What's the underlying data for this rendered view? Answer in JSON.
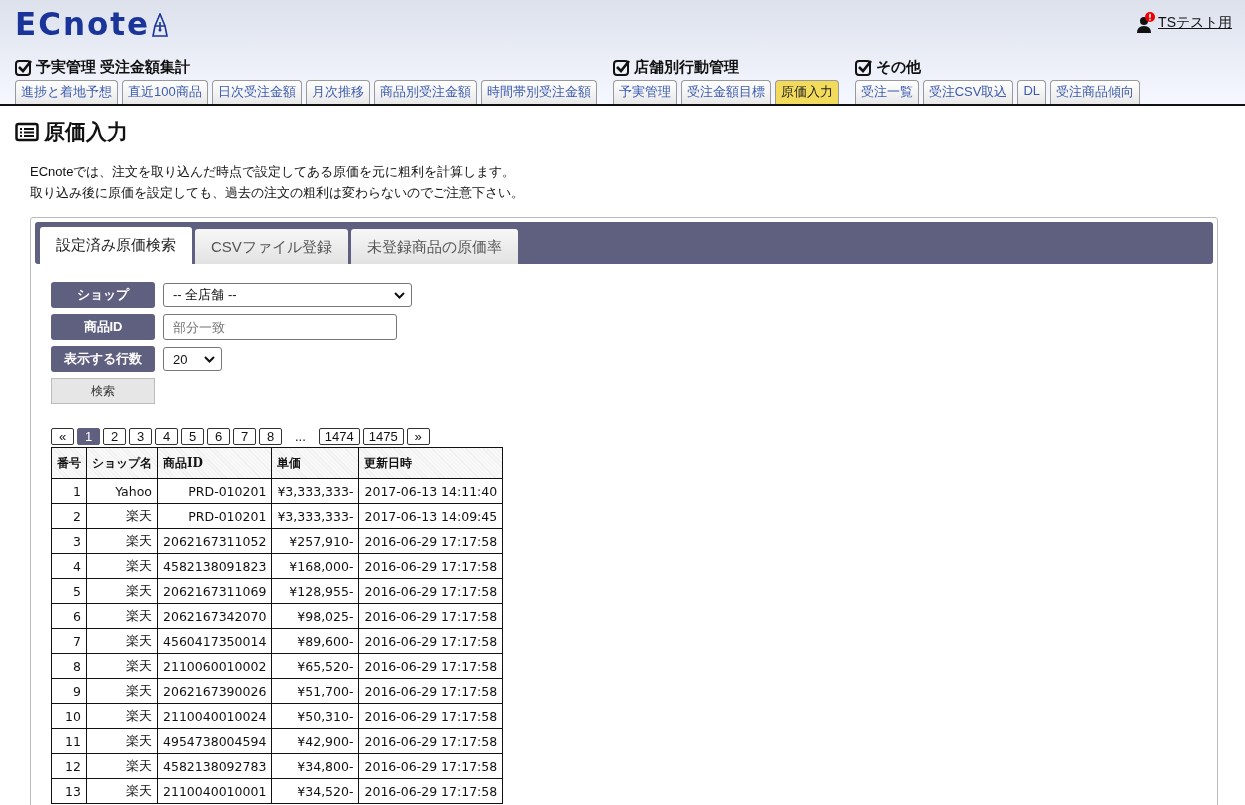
{
  "header": {
    "logo": "ECnote",
    "user": "TSテスト用"
  },
  "nav_groups": [
    {
      "title": "予実管理 受注金額集計",
      "checked": true,
      "tabs": [
        {
          "label": "進捗と着地予想",
          "selected": false
        },
        {
          "label": "直近100商品",
          "selected": false
        },
        {
          "label": "日次受注金額",
          "selected": false
        },
        {
          "label": "月次推移",
          "selected": false
        },
        {
          "label": "商品別受注金額",
          "selected": false
        },
        {
          "label": "時間帯別受注金額",
          "selected": false
        }
      ]
    },
    {
      "title": "店舗別行動管理",
      "checked": true,
      "tabs": [
        {
          "label": "予実管理",
          "selected": false
        },
        {
          "label": "受注金額目標",
          "selected": false
        },
        {
          "label": "原価入力",
          "selected": true
        }
      ]
    },
    {
      "title": "その他",
      "checked": true,
      "tabs": [
        {
          "label": "受注一覧",
          "selected": false
        },
        {
          "label": "受注CSV取込",
          "selected": false
        },
        {
          "label": "DL",
          "selected": false
        },
        {
          "label": "受注商品傾向",
          "selected": false
        }
      ]
    }
  ],
  "page": {
    "title": "原価入力",
    "description": [
      "ECnoteでは、注文を取り込んだ時点で設定してある原価を元に粗利を計算します。",
      "取り込み後に原価を設定しても、過去の注文の粗利は変わらないのでご注意下さい。"
    ]
  },
  "panel_tabs": [
    {
      "label": "設定済み原価検索",
      "selected": true
    },
    {
      "label": "CSVファイル登録",
      "selected": false
    },
    {
      "label": "未登録商品の原価率",
      "selected": false
    }
  ],
  "form": {
    "fields": [
      {
        "label": "ショップ",
        "kind": "select",
        "value": "-- 全店舗 --"
      },
      {
        "label": "商品ID",
        "kind": "text",
        "placeholder": "部分一致"
      },
      {
        "label": "表示する行数",
        "kind": "select",
        "value": "20"
      }
    ],
    "search_button": "検索"
  },
  "pagination": [
    {
      "kind": "page",
      "label": "«",
      "selected": false
    },
    {
      "kind": "page",
      "label": "1",
      "selected": true
    },
    {
      "kind": "page",
      "label": "2",
      "selected": false
    },
    {
      "kind": "page",
      "label": "3",
      "selected": false
    },
    {
      "kind": "page",
      "label": "4",
      "selected": false
    },
    {
      "kind": "page",
      "label": "5",
      "selected": false
    },
    {
      "kind": "page",
      "label": "6",
      "selected": false
    },
    {
      "kind": "page",
      "label": "7",
      "selected": false
    },
    {
      "kind": "page",
      "label": "8",
      "selected": false
    },
    {
      "kind": "ellipsis",
      "label": "..."
    },
    {
      "kind": "page",
      "label": "1474",
      "selected": false
    },
    {
      "kind": "page",
      "label": "1475",
      "selected": false
    },
    {
      "kind": "page",
      "label": "»",
      "selected": false
    }
  ],
  "table": {
    "columns": [
      "番号",
      "ショップ名",
      "商品ID",
      "単価",
      "更新日時"
    ],
    "rows": [
      [
        "1",
        "Yahoo",
        "PRD-010201",
        "¥3,333,333-",
        "2017-06-13 14:11:40"
      ],
      [
        "2",
        "楽天",
        "PRD-010201",
        "¥3,333,333-",
        "2017-06-13 14:09:45"
      ],
      [
        "3",
        "楽天",
        "2062167311052",
        "¥257,910-",
        "2016-06-29 17:17:58"
      ],
      [
        "4",
        "楽天",
        "4582138091823",
        "¥168,000-",
        "2016-06-29 17:17:58"
      ],
      [
        "5",
        "楽天",
        "2062167311069",
        "¥128,955-",
        "2016-06-29 17:17:58"
      ],
      [
        "6",
        "楽天",
        "2062167342070",
        "¥98,025-",
        "2016-06-29 17:17:58"
      ],
      [
        "7",
        "楽天",
        "4560417350014",
        "¥89,600-",
        "2016-06-29 17:17:58"
      ],
      [
        "8",
        "楽天",
        "2110060010002",
        "¥65,520-",
        "2016-06-29 17:17:58"
      ],
      [
        "9",
        "楽天",
        "2062167390026",
        "¥51,700-",
        "2016-06-29 17:17:58"
      ],
      [
        "10",
        "楽天",
        "2110040010024",
        "¥50,310-",
        "2016-06-29 17:17:58"
      ],
      [
        "11",
        "楽天",
        "4954738004594",
        "¥42,900-",
        "2016-06-29 17:17:58"
      ],
      [
        "12",
        "楽天",
        "4582138092783",
        "¥34,800-",
        "2016-06-29 17:17:58"
      ],
      [
        "13",
        "楽天",
        "2110040010001",
        "¥34,520-",
        "2016-06-29 17:17:58"
      ]
    ]
  }
}
